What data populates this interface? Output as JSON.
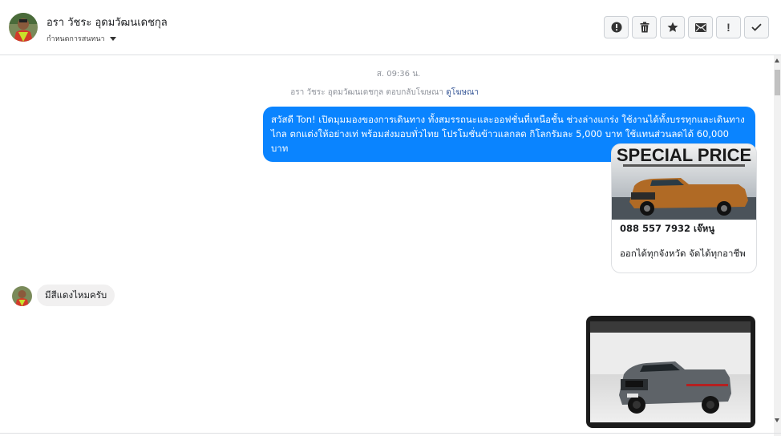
{
  "header": {
    "contact_name": "อรา วัชระ อุดมวัฒนเดชกุล",
    "subnav_label": "กำหนดการสนทนา",
    "actions": [
      {
        "name": "report-button",
        "icon": "alert-circle-icon"
      },
      {
        "name": "delete-button",
        "icon": "trash-icon"
      },
      {
        "name": "star-button",
        "icon": "star-icon"
      },
      {
        "name": "mail-button",
        "icon": "envelope-icon"
      },
      {
        "name": "important-button",
        "icon": "exclamation-icon",
        "glyph": "!"
      },
      {
        "name": "done-button",
        "icon": "check-icon"
      }
    ]
  },
  "conversation": {
    "timestamp": "ส. 09:36 น.",
    "reply_line": {
      "text": "อรา วัชระ อุดมวัฒนเดชกุล ตอบกลับโฆษณา",
      "link": "ดูโฆษณา"
    },
    "outgoing_message": "สวัสดี Ton! เปิดมุมมองของการเดินทาง ทั้งสมรรถนะและออฟชั่นที่เหนือชั้น ช่วงล่างแกร่ง ใช้งานได้ทั้งบรรทุกและเดินทางไกล ตกแต่งให้อย่างเท่ พร้อมส่งมอบทั่วไทย โปรโมชั่นข้าวแลกลด กิโลกรัมละ 5,000 บาท ใช้แทนส่วนลดได้ 60,000 บาท",
    "ad_card": {
      "banner_text": "SPECIAL PRICE",
      "phone": "088 557 7932 เจ๊หนู",
      "description": "ออกได้ทุกจังหวัด จัดได้ทุกอาชีพ"
    },
    "incoming_message": "มีสีแดงไหมครับ"
  },
  "colors": {
    "accent": "#0a84ff",
    "incoming_bubble": "#f1f0f0",
    "meta_text": "#90949c",
    "link": "#385898"
  }
}
